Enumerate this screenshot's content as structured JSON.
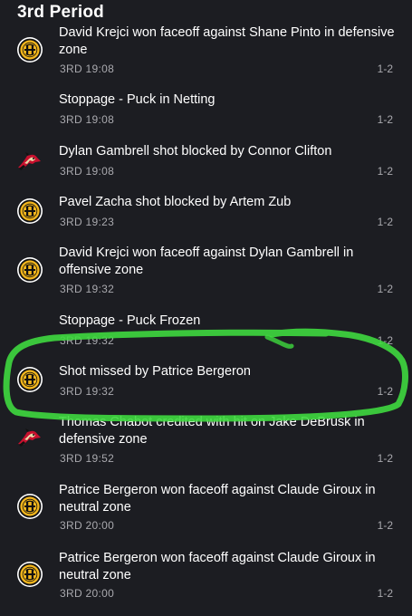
{
  "period_title": "3rd Period",
  "events": [
    {
      "team": "bruins",
      "description": "David Krejci won faceoff against Shane Pinto in defensive zone",
      "time": "3RD 19:08",
      "score": "1-2"
    },
    {
      "team": "none",
      "description": "Stoppage - Puck in Netting",
      "time": "3RD 19:08",
      "score": "1-2"
    },
    {
      "team": "senators",
      "description": "Dylan Gambrell shot blocked by Connor Clifton",
      "time": "3RD 19:08",
      "score": "1-2"
    },
    {
      "team": "bruins",
      "description": "Pavel Zacha shot blocked by Artem Zub",
      "time": "3RD 19:23",
      "score": "1-2"
    },
    {
      "team": "bruins",
      "description": "David Krejci won faceoff against Dylan Gambrell in offensive zone",
      "time": "3RD 19:32",
      "score": "1-2"
    },
    {
      "team": "none",
      "description": "Stoppage - Puck Frozen",
      "time": "3RD 19:32",
      "score": "1-2"
    },
    {
      "team": "bruins",
      "description": "Shot missed by Patrice Bergeron",
      "time": "3RD 19:32",
      "score": "1-2"
    },
    {
      "team": "senators",
      "description": "Thomas Chabot credited with hit on Jake DeBrusk in defensive zone",
      "time": "3RD 19:52",
      "score": "1-2"
    },
    {
      "team": "bruins",
      "description": "Patrice Bergeron won faceoff against Claude Giroux in neutral zone",
      "time": "3RD 20:00",
      "score": "1-2"
    },
    {
      "team": "bruins",
      "description": "Patrice Bergeron won faceoff against Claude Giroux in neutral zone",
      "time": "3RD 20:00",
      "score": "1-2"
    }
  ],
  "colors": {
    "background": "#1c1d22",
    "text_primary": "#ffffff",
    "text_secondary": "#a9a9ae",
    "highlight": "#3fd93f",
    "bruins_gold": "#f2b51c",
    "senators_red": "#c8102e"
  },
  "icons": {
    "bruins": "bruins-logo-icon",
    "senators": "senators-logo-icon"
  }
}
